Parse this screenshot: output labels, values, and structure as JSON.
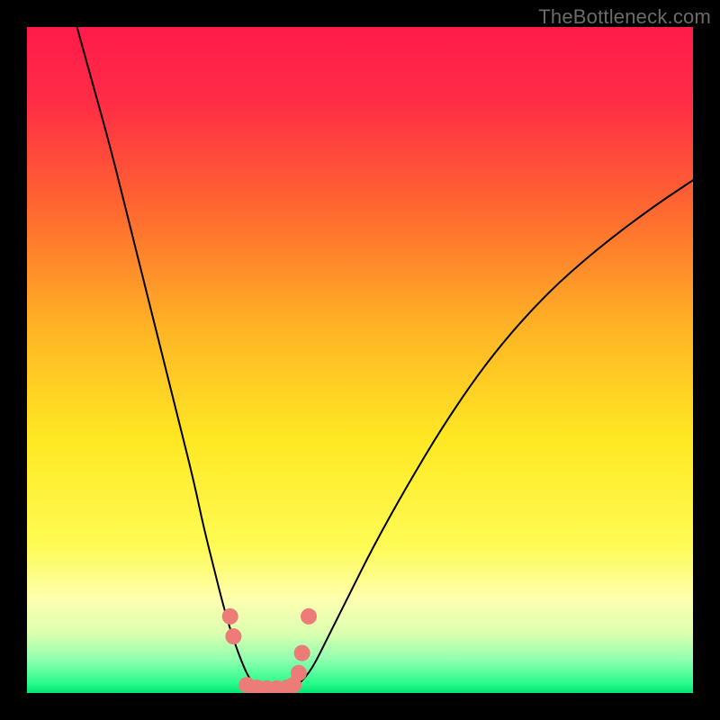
{
  "watermark": "TheBottleneck.com",
  "chart_data": {
    "type": "line",
    "title": "",
    "xlabel": "",
    "ylabel": "",
    "xlim": [
      0,
      100
    ],
    "ylim": [
      0,
      100
    ],
    "background_gradient": {
      "stops": [
        {
          "offset": 0.0,
          "color": "#ff1a4b"
        },
        {
          "offset": 0.12,
          "color": "#ff2f45"
        },
        {
          "offset": 0.28,
          "color": "#ff6a2f"
        },
        {
          "offset": 0.45,
          "color": "#ffb325"
        },
        {
          "offset": 0.62,
          "color": "#ffe823"
        },
        {
          "offset": 0.78,
          "color": "#fffb55"
        },
        {
          "offset": 0.86,
          "color": "#fdffb0"
        },
        {
          "offset": 0.91,
          "color": "#dcffb0"
        },
        {
          "offset": 0.95,
          "color": "#8fffb0"
        },
        {
          "offset": 0.985,
          "color": "#2bfc8b"
        },
        {
          "offset": 1.0,
          "color": "#00e472"
        }
      ]
    },
    "series": [
      {
        "name": "left-curve",
        "type": "line",
        "color": "#000000",
        "width": 2,
        "x": [
          7.5,
          10,
          12.5,
          15,
          17.5,
          20,
          22.5,
          25,
          26.5,
          28,
          29.5,
          31,
          32.5,
          33.5,
          34.5
        ],
        "y": [
          100,
          91,
          82,
          72,
          62,
          52,
          42,
          32,
          25,
          19,
          13,
          8,
          4,
          2,
          0.7
        ]
      },
      {
        "name": "right-curve",
        "type": "line",
        "color": "#000000",
        "width": 2,
        "x": [
          40,
          41.5,
          43,
          45,
          48,
          52,
          57,
          63,
          70,
          78,
          86,
          94,
          100
        ],
        "y": [
          0.7,
          2,
          4,
          8,
          14,
          22,
          31,
          41,
          51,
          60,
          67,
          73,
          77
        ]
      },
      {
        "name": "bottom-dots",
        "type": "scatter",
        "color": "#ed7b78",
        "radius": 9,
        "x": [
          30.5,
          31.0,
          33.0,
          34.5,
          36.0,
          37.5,
          39.0,
          40.0,
          40.8,
          41.3
        ],
        "y": [
          11.5,
          8.5,
          1.2,
          0.8,
          0.7,
          0.7,
          0.8,
          1.2,
          3.0,
          6.0
        ]
      },
      {
        "name": "upper-dots",
        "type": "scatter",
        "color": "#ed7b78",
        "radius": 9,
        "x": [
          42.3
        ],
        "y": [
          11.5
        ]
      }
    ]
  }
}
